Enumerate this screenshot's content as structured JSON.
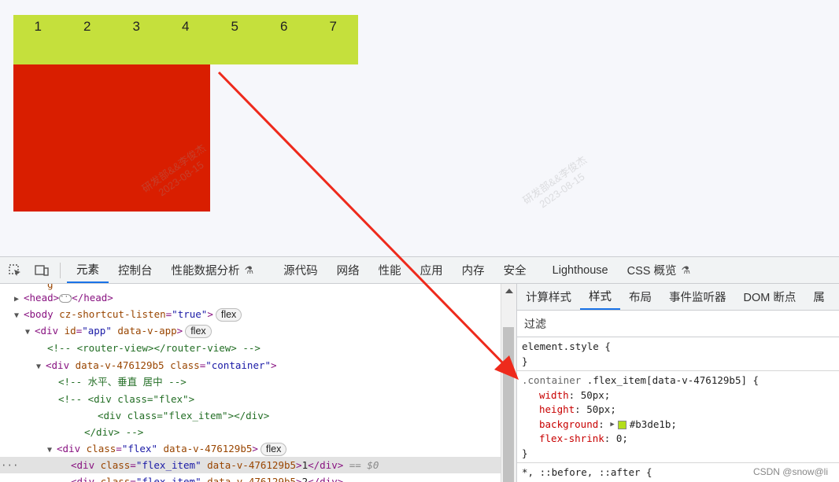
{
  "preview": {
    "numbers": [
      "1",
      "2",
      "3",
      "4",
      "5",
      "6",
      "7"
    ],
    "flex_color": "#c5e03c",
    "box_color": "#d91e00",
    "watermark": [
      "研发部&&李俊杰",
      "2023-08-15"
    ]
  },
  "toolbar": {
    "tabs": [
      "元素",
      "控制台",
      "性能数据分析",
      "源代码",
      "网络",
      "性能",
      "应用",
      "内存",
      "安全",
      "Lighthouse",
      "CSS 概览"
    ],
    "active_tab": "元素"
  },
  "elements": {
    "lines": [
      {
        "head_open": "<head>",
        "head_close": "</head>"
      },
      {
        "tag": "<body",
        "attr": "cz-shortcut-listen",
        "val": "\"true\"",
        "badge": "flex"
      },
      {
        "tag": "<div",
        "attr": "id",
        "val": "\"app\"",
        "attr2": "data-v-app",
        "badge": "flex"
      },
      {
        "comment": "<!-- <router-view></router-view> -->"
      },
      {
        "tag": "<div",
        "attr": "data-v-476129b5",
        "attr2": "class",
        "val": "\"container\""
      },
      {
        "comment": "<!-- 水平、垂直 居中 -->"
      },
      {
        "comment": "<!-- <div class=\"flex\">"
      },
      {
        "comment": "<div class=\"flex_item\"></div>"
      },
      {
        "comment": "</div> -->"
      },
      {
        "tag": "<div",
        "attr": "class",
        "val": "\"flex\"",
        "attr2": "data-v-476129b5",
        "badge": "flex"
      },
      {
        "tag": "<div",
        "attr": "class",
        "val": "\"flex_item\"",
        "attr2": "data-v-476129b5",
        "text": "1",
        "close": "</div>",
        "eq": "== $0"
      },
      {
        "tag": "<div",
        "attr": "class",
        "val": "\"flex_item\"",
        "attr2": "data-v-476129b5",
        "text": "2",
        "close": "</div>"
      }
    ]
  },
  "styles": {
    "tabs": [
      "计算样式",
      "样式",
      "布局",
      "事件监听器",
      "DOM 断点",
      "属"
    ],
    "active_tab": "样式",
    "filter_label": "过滤",
    "element_style": "element.style {",
    "close_brace": "}",
    "rule_selector_a": ".container ",
    "rule_selector_b": ".flex_item[data-v-476129b5] {",
    "props": [
      {
        "name": "width",
        "value": "50px;"
      },
      {
        "name": "height",
        "value": "50px;"
      },
      {
        "name": "background",
        "value": "#b3de1b;"
      },
      {
        "name": "flex-shrink",
        "value": "0;"
      }
    ],
    "swatch_color": "#b3de1b",
    "next_rule": "*, ::before, ::after {",
    "credit": "CSDN @snow@li"
  },
  "annotation_color": "#ee2a1c"
}
